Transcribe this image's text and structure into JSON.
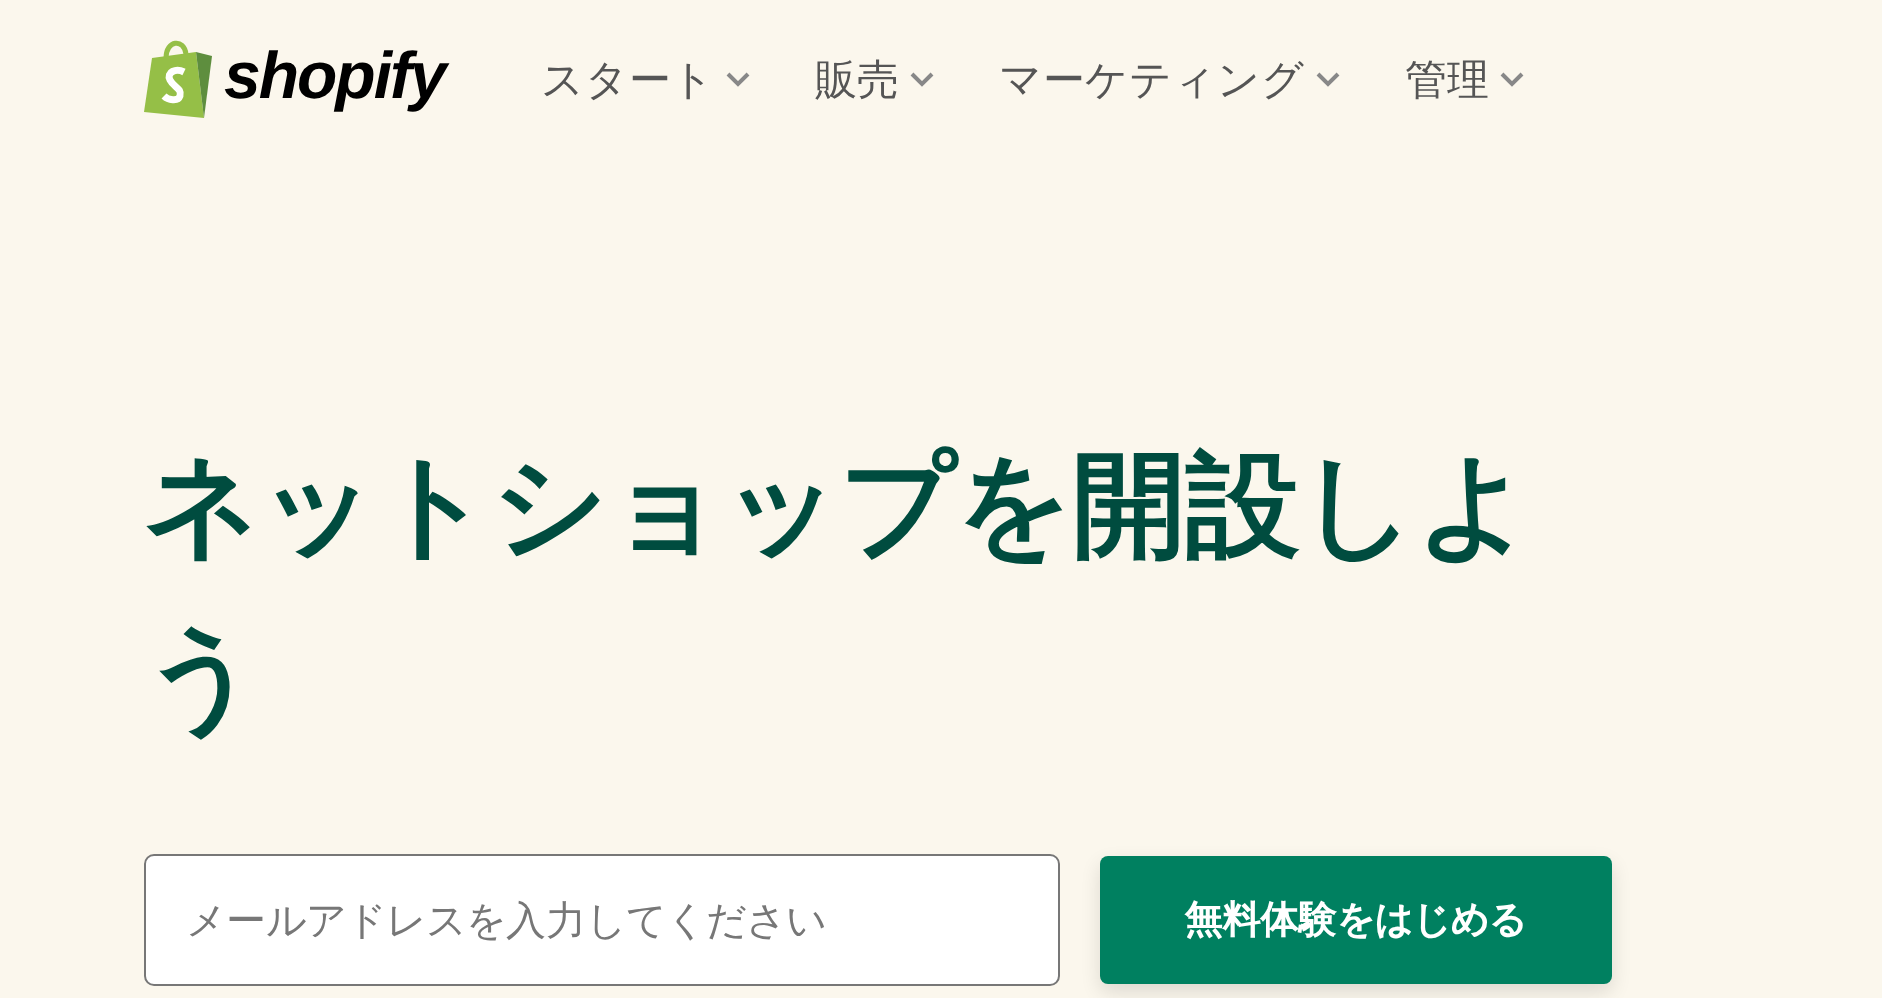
{
  "logo": {
    "text": "shopify"
  },
  "nav": [
    {
      "label": "スタート"
    },
    {
      "label": "販売"
    },
    {
      "label": "マーケティング"
    },
    {
      "label": "管理"
    }
  ],
  "hero": {
    "heading": "ネットショップを開設しよう"
  },
  "signup": {
    "email": {
      "placeholder": "メールアドレスを入力してください"
    },
    "button": "無料体験をはじめる"
  }
}
